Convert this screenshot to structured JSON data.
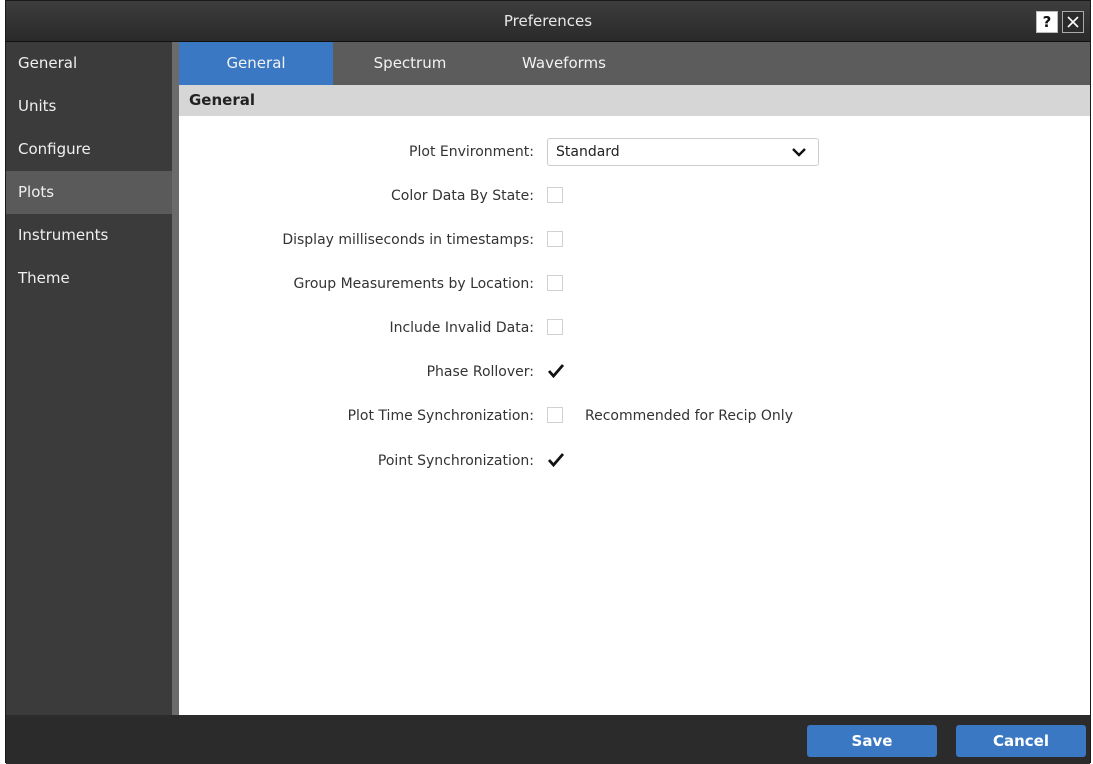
{
  "window": {
    "title": "Preferences",
    "help_label": "?",
    "close_label": "✕"
  },
  "sidebar": {
    "items": [
      {
        "label": "General"
      },
      {
        "label": "Units"
      },
      {
        "label": "Configure"
      },
      {
        "label": "Plots",
        "active": true
      },
      {
        "label": "Instruments"
      },
      {
        "label": "Theme"
      }
    ]
  },
  "tabs": [
    {
      "label": "General",
      "active": true
    },
    {
      "label": "Spectrum"
    },
    {
      "label": "Waveforms"
    }
  ],
  "section": {
    "title": "General"
  },
  "form": {
    "plot_environment": {
      "label": "Plot Environment:",
      "value": "Standard"
    },
    "color_data_by_state": {
      "label": "Color Data By State:",
      "checked": false
    },
    "display_milliseconds": {
      "label": "Display milliseconds in timestamps:",
      "checked": false
    },
    "group_measurements": {
      "label": "Group Measurements by Location:",
      "checked": false
    },
    "include_invalid": {
      "label": "Include Invalid Data:",
      "checked": false
    },
    "phase_rollover": {
      "label": "Phase Rollover:",
      "checked": true
    },
    "plot_time_sync": {
      "label": "Plot Time Synchronization:",
      "checked": false,
      "note": "Recommended for Recip Only"
    },
    "point_sync": {
      "label": "Point Synchronization:",
      "checked": true
    }
  },
  "footer": {
    "save_label": "Save",
    "cancel_label": "Cancel"
  },
  "colors": {
    "accent": "#3a78c4",
    "sidebar_bg": "#3b3b3b",
    "sidebar_active": "#5a5a5a",
    "tabbar_bg": "#5c5c5c",
    "section_bg": "#d6d6d6"
  }
}
